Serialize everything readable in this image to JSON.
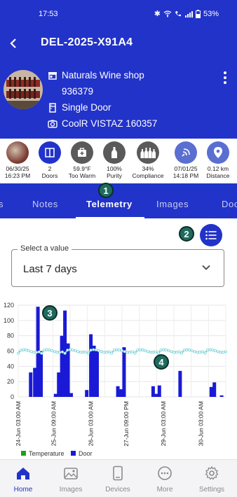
{
  "status_bar": {
    "time": "17:53",
    "battery": "53%"
  },
  "app_bar": {
    "title": "DEL-2025-X91A4"
  },
  "outlet": {
    "name": "Naturals Wine shop",
    "code": "936379",
    "door_type": "Single Door",
    "device": "CoolR VISTAZ  160357"
  },
  "stats": [
    {
      "line1": "06/30/25",
      "line2": "16:23 PM",
      "icon": "photo-thumbnail"
    },
    {
      "line1": "2",
      "line2": "Doors",
      "icon": "door-icon"
    },
    {
      "line1": "59.9°F",
      "line2": "Too Warm",
      "icon": "first-aid-icon"
    },
    {
      "line1": "100%",
      "line2": "Purity",
      "icon": "bottle-icon"
    },
    {
      "line1": "34%",
      "line2": "Compliance",
      "icon": "bottles-icon"
    },
    {
      "line1": "07/01/25",
      "line2": "14:18 PM",
      "icon": "satellite-icon"
    },
    {
      "line1": "0.12 km",
      "line2": "Distance",
      "icon": "location-pin-icon"
    }
  ],
  "tabs": {
    "partial_left": "s",
    "notes": "Notes",
    "telemetry": "Telemetry",
    "images": "Images",
    "partial_right": "Doo"
  },
  "badges": {
    "b1": "1",
    "b2": "2",
    "b3": "3",
    "b4": "4"
  },
  "filter": {
    "label": "Select a value",
    "value": "Last 7 days"
  },
  "colors": {
    "primary": "#2233c9",
    "temperature": "#1aa31a",
    "door": "#1a1ad6",
    "temp_line": "#7fd3d8"
  },
  "chart_data": {
    "type": "bar",
    "yticks": [
      "0",
      "20",
      "40",
      "60",
      "80",
      "100",
      "120"
    ],
    "ylim": [
      0,
      120
    ],
    "xticks": [
      "24-Jun 03:00 AM",
      "25-Jun 09:00 AM",
      "26-Jun 03:00 AM",
      "27-Jun 09:00 PM",
      "27-Jun 09:00 PM",
      "29-Jun 03:00 AM",
      "30-Jun 03:00 AM"
    ],
    "legend": [
      "Temperature",
      "Door"
    ],
    "door_bars": [
      {
        "x": 0.06,
        "v": 32
      },
      {
        "x": 0.08,
        "v": 38
      },
      {
        "x": 0.095,
        "v": 118
      },
      {
        "x": 0.11,
        "v": 60
      },
      {
        "x": 0.18,
        "v": 4
      },
      {
        "x": 0.195,
        "v": 32
      },
      {
        "x": 0.21,
        "v": 80
      },
      {
        "x": 0.225,
        "v": 113
      },
      {
        "x": 0.24,
        "v": 70
      },
      {
        "x": 0.255,
        "v": 5
      },
      {
        "x": 0.33,
        "v": 9
      },
      {
        "x": 0.35,
        "v": 82
      },
      {
        "x": 0.365,
        "v": 67
      },
      {
        "x": 0.38,
        "v": 60
      },
      {
        "x": 0.48,
        "v": 14
      },
      {
        "x": 0.495,
        "v": 10
      },
      {
        "x": 0.51,
        "v": 65
      },
      {
        "x": 0.65,
        "v": 14
      },
      {
        "x": 0.665,
        "v": 4
      },
      {
        "x": 0.68,
        "v": 15
      },
      {
        "x": 0.78,
        "v": 34
      },
      {
        "x": 0.93,
        "v": 13
      },
      {
        "x": 0.945,
        "v": 19
      },
      {
        "x": 0.98,
        "v": 2
      }
    ],
    "temp_series_level": 60
  },
  "bottom_nav": [
    {
      "label": "Home",
      "icon": "home-icon",
      "active": true
    },
    {
      "label": "Images",
      "icon": "images-icon",
      "active": false
    },
    {
      "label": "Devices",
      "icon": "device-icon",
      "active": false
    },
    {
      "label": "More",
      "icon": "more-icon",
      "active": false
    },
    {
      "label": "Settings",
      "icon": "settings-icon",
      "active": false
    }
  ]
}
